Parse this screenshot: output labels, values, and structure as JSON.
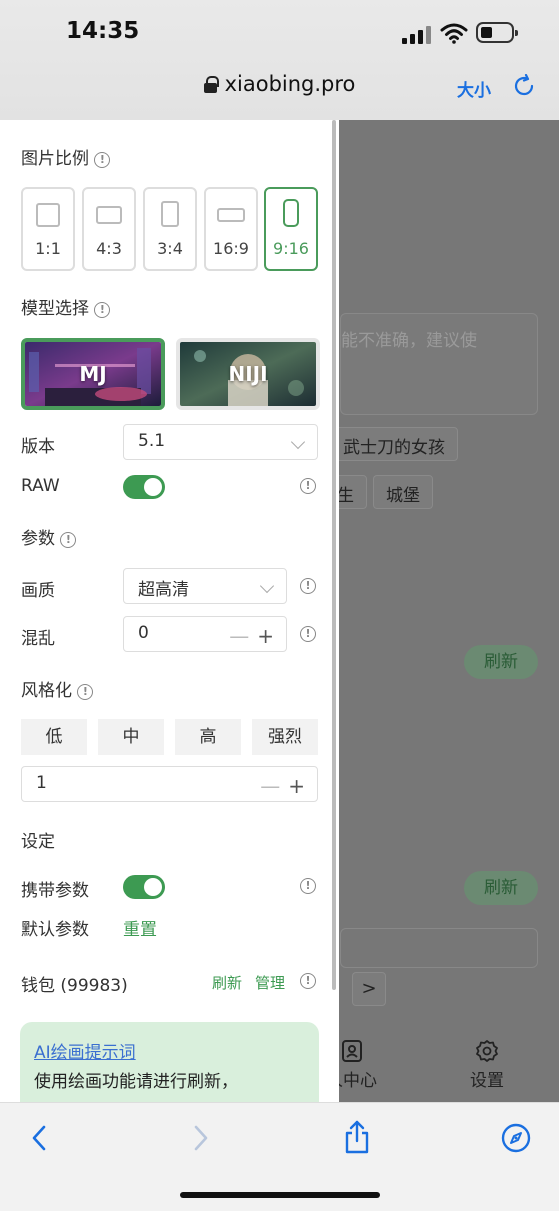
{
  "status": {
    "time": "14:35"
  },
  "browser": {
    "url": "xiaobing.pro",
    "text_size": "大小"
  },
  "drawer": {
    "ratio_label": "图片比例",
    "ratios": [
      "1:1",
      "4:3",
      "3:4",
      "16:9",
      "9:16"
    ],
    "ratio_selected": "9:16",
    "model_label": "模型选择",
    "models": [
      "MJ",
      "NIJI"
    ],
    "model_selected": "MJ",
    "version_label": "版本",
    "version_value": "5.1",
    "raw_label": "RAW",
    "raw_on": true,
    "params_label": "参数",
    "quality_label": "画质",
    "quality_value": "超高清",
    "chaos_label": "混乱",
    "chaos_value": "0",
    "stylize_label": "风格化",
    "stylize_options": [
      "低",
      "中",
      "高",
      "强烈"
    ],
    "stylize_value": "1",
    "settings_label": "设定",
    "carry_params_label": "携带参数",
    "carry_params_on": true,
    "default_params_label": "默认参数",
    "reset_label": "重置",
    "wallet_label": "钱包 (99983)",
    "wallet_refresh": "刷新",
    "wallet_manage": "管理",
    "tip_link": "AI绘画提示词",
    "tip_text": "使用绘画功能请进行刷新，"
  },
  "background": {
    "prompt_placeholder": "能不准确，建议使",
    "chips": [
      "武士刀的女孩",
      "生",
      "城堡"
    ],
    "refresh_1": "刷新",
    "refresh_2": "刷新",
    "next": ">",
    "tabs": [
      "人中心",
      "设置"
    ]
  },
  "colors": {
    "accent": "#3d9a52",
    "link": "#1a6fe0"
  }
}
